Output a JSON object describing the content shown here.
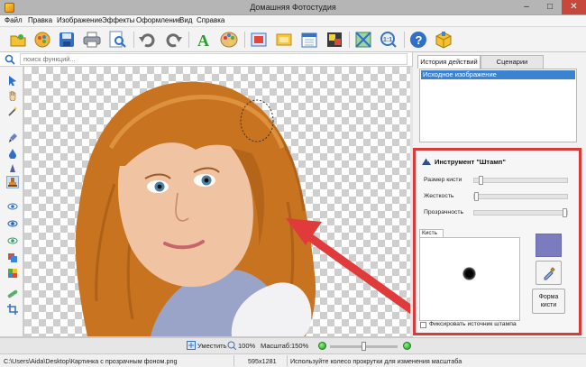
{
  "window": {
    "title": "Домашняя Фотостудия",
    "minimize": "–",
    "maximize": "□",
    "close": "✕"
  },
  "menu": [
    "Файл",
    "Правка",
    "Изображение",
    "Эффекты",
    "Оформление",
    "Вид",
    "Справка"
  ],
  "toolbar": [
    "open-icon",
    "gallery-icon",
    "save-icon",
    "print-icon",
    "preview-icon",
    "undo-icon",
    "redo-icon",
    "text-icon",
    "palette-icon",
    "frame-icon",
    "card-icon",
    "calendar-icon",
    "collage-icon",
    "crop-icon",
    "actual-size-icon",
    "help-icon",
    "package-icon"
  ],
  "search": {
    "placeholder": "поиск функций..."
  },
  "tools": [
    "pointer-icon",
    "hand-icon",
    "magic-wand-icon",
    "brush-icon",
    "drop-icon",
    "sharpen-icon",
    "stamp-icon",
    "eye-icon",
    "eye-blue-icon",
    "eye-red-icon",
    "layers-icon",
    "color-blocks-icon",
    "bandage-icon",
    "crop-tool-icon"
  ],
  "right_panel": {
    "tabs": [
      "История действий",
      "Сценарии"
    ],
    "history": [
      "Исходное изображение"
    ]
  },
  "tool_panel": {
    "title": "Инструмент \"Штамп\"",
    "brush_size": {
      "label": "Размер кисти",
      "value": 0.05
    },
    "hardness": {
      "label": "Жесткость",
      "value": 0.0
    },
    "opacity": {
      "label": "Прозрачность",
      "value": 1.0
    },
    "brush_tab": "Кисть",
    "color": "#7b7bbf",
    "form_button": "Форма кисти",
    "fix_source": {
      "label": "Фиксировать источник штампа",
      "checked": false
    }
  },
  "zoombar": {
    "fit": "Уместить",
    "percent": "100%",
    "scale_label": "Масштаб:",
    "scale_value": "150%",
    "zoom_level": 0.5
  },
  "status": {
    "path": "C:\\Users\\Aida\\Desktop\\Картинка с прозрачным фоном.png",
    "dimensions": "595x1281",
    "hint": "Используйте колесо прокрутки для изменения масштаба"
  },
  "colors": {
    "accent": "#3b83d1",
    "highlight_border": "#d93b3b",
    "arrow": "#e03a3a",
    "hair": "#c8731f"
  }
}
